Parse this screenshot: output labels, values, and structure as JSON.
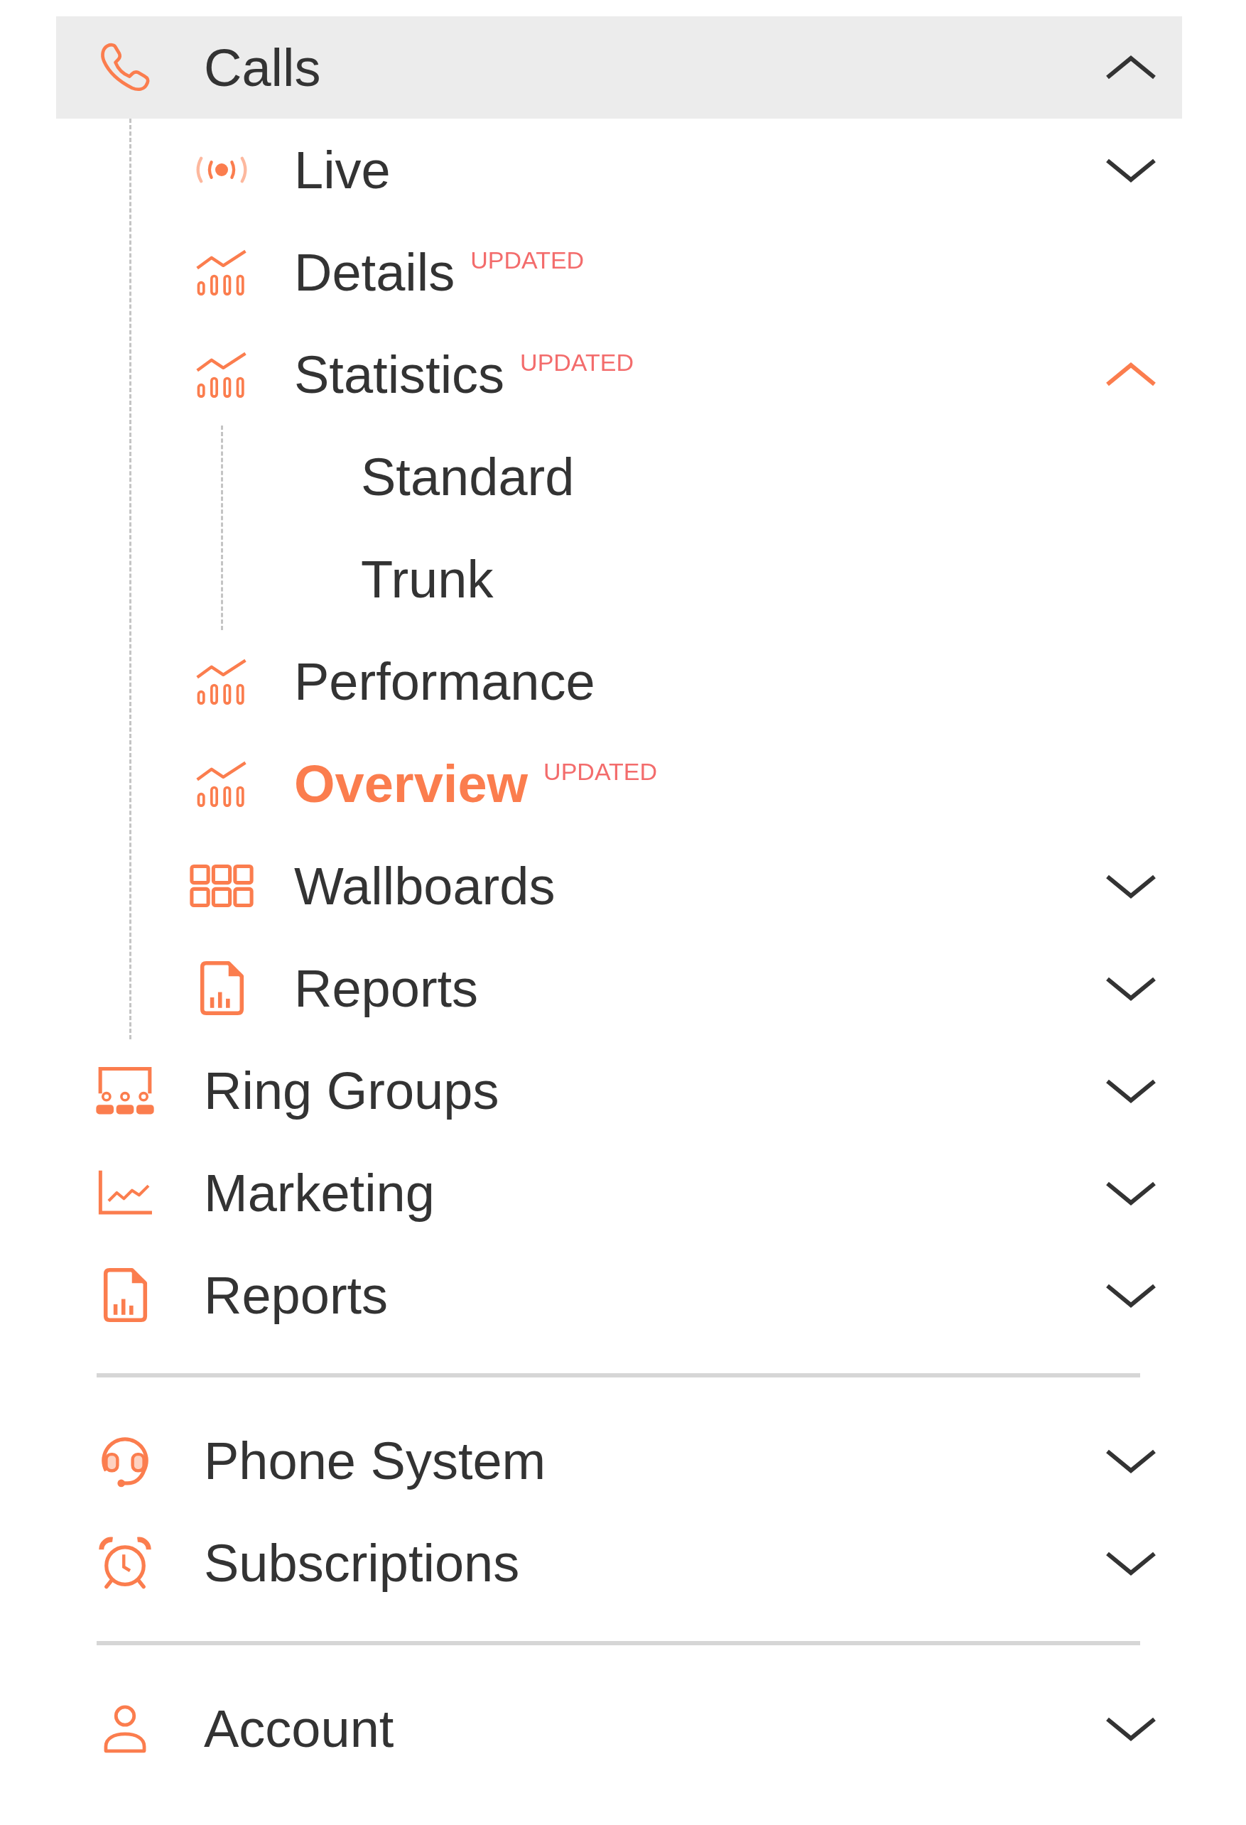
{
  "menu": {
    "sections": [
      {
        "items": [
          {
            "label": "Calls",
            "selected": false,
            "expanded": true,
            "children": [
              {
                "label": "Live",
                "selected": false,
                "expanded": false
              },
              {
                "label": "Details",
                "badge": "UPDATED",
                "selected": false
              },
              {
                "label": "Statistics",
                "badge": "UPDATED",
                "selected": false,
                "expanded": true,
                "children": [
                  {
                    "label": "Standard",
                    "selected": false
                  },
                  {
                    "label": "Trunk",
                    "selected": false
                  }
                ]
              },
              {
                "label": "Performance",
                "selected": false
              },
              {
                "label": "Overview",
                "badge": "UPDATED",
                "selected": true
              },
              {
                "label": "Wallboards",
                "selected": false,
                "expanded": false
              },
              {
                "label": "Reports",
                "selected": false,
                "expanded": false
              }
            ]
          },
          {
            "label": "Ring Groups",
            "selected": false,
            "expanded": false
          },
          {
            "label": "Marketing",
            "selected": false,
            "expanded": false
          },
          {
            "label": "Reports",
            "selected": false,
            "expanded": false
          }
        ]
      },
      {
        "items": [
          {
            "label": "Phone System",
            "selected": false,
            "expanded": false
          },
          {
            "label": "Subscriptions",
            "selected": false,
            "expanded": false
          }
        ]
      },
      {
        "items": [
          {
            "label": "Account",
            "selected": false,
            "expanded": false
          }
        ]
      }
    ]
  }
}
